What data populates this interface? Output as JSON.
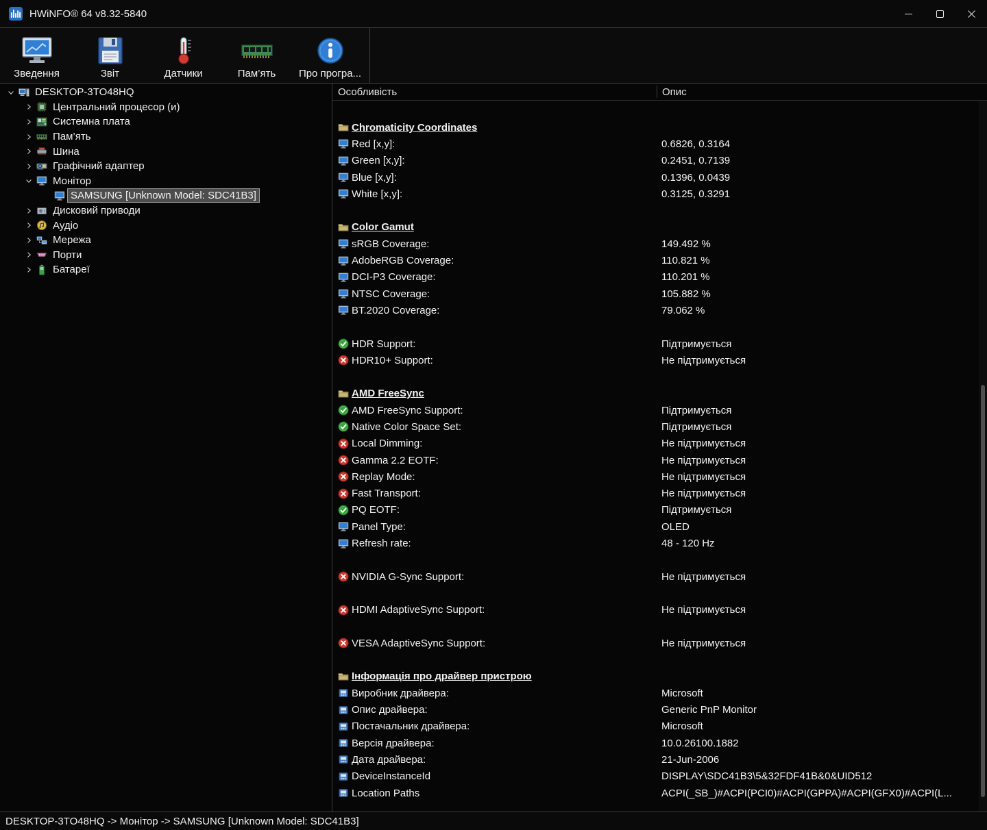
{
  "window": {
    "title": "HWiNFO® 64 v8.32-5840"
  },
  "toolbar": {
    "items": [
      {
        "name": "summary",
        "label": "Зведення",
        "icon": "summary-icon"
      },
      {
        "name": "report",
        "label": "Звіт",
        "icon": "report-icon"
      },
      {
        "name": "sensors",
        "label": "Датчики",
        "icon": "sensors-icon"
      },
      {
        "name": "memory",
        "label": "Пам’ять",
        "icon": "memory-toolbar-icon"
      },
      {
        "name": "about",
        "label": "Про програ...",
        "icon": "about-icon"
      }
    ]
  },
  "tree": {
    "items": [
      {
        "name": "desktop-root",
        "label": "DESKTOP-3TO48HQ",
        "icon": "computer-icon",
        "level": 0,
        "state": "expanded",
        "selected": false
      },
      {
        "name": "cpu",
        "label": "Центральний процесор (и)",
        "icon": "cpu-icon",
        "level": 1,
        "state": "collapsed",
        "selected": false
      },
      {
        "name": "motherboard",
        "label": "Системна плата",
        "icon": "motherboard-icon",
        "level": 1,
        "state": "collapsed",
        "selected": false
      },
      {
        "name": "memory",
        "label": "Пам’ять",
        "icon": "memory-icon",
        "level": 1,
        "state": "collapsed",
        "selected": false
      },
      {
        "name": "bus",
        "label": "Шина",
        "icon": "bus-icon",
        "level": 1,
        "state": "collapsed",
        "selected": false
      },
      {
        "name": "gpu",
        "label": "Графічний адаптер",
        "icon": "gpu-icon",
        "level": 1,
        "state": "collapsed",
        "selected": false
      },
      {
        "name": "monitor",
        "label": "Монітор",
        "icon": "monitor-icon",
        "level": 1,
        "state": "expanded",
        "selected": false
      },
      {
        "name": "samsung-sdc41b3",
        "label": "SAMSUNG [Unknown Model: SDC41B3]",
        "icon": "monitor-icon",
        "level": 2,
        "state": "leaf",
        "selected": true
      },
      {
        "name": "disk-drives",
        "label": "Дисковий приводи",
        "icon": "disk-icon",
        "level": 1,
        "state": "collapsed",
        "selected": false
      },
      {
        "name": "audio",
        "label": "Аудіо",
        "icon": "audio-icon",
        "level": 1,
        "state": "collapsed",
        "selected": false
      },
      {
        "name": "network",
        "label": "Мережа",
        "icon": "network-icon",
        "level": 1,
        "state": "collapsed",
        "selected": false
      },
      {
        "name": "ports",
        "label": "Порти",
        "icon": "ports-icon",
        "level": 1,
        "state": "collapsed",
        "selected": false
      },
      {
        "name": "batteries",
        "label": "Батареї",
        "icon": "battery-icon",
        "level": 1,
        "state": "collapsed",
        "selected": false
      }
    ]
  },
  "details": {
    "columns": [
      "Особливість",
      "Опис"
    ],
    "rows": [
      {
        "type": "section",
        "icon": "folder-icon",
        "label": "Chromaticity Coordinates"
      },
      {
        "type": "prop",
        "icon": "monitor-icon",
        "label": "Red [x,y]:",
        "value": "0.6826, 0.3164"
      },
      {
        "type": "prop",
        "icon": "monitor-icon",
        "label": "Green [x,y]:",
        "value": "0.2451, 0.7139"
      },
      {
        "type": "prop",
        "icon": "monitor-icon",
        "label": "Blue [x,y]:",
        "value": "0.1396, 0.0439"
      },
      {
        "type": "prop",
        "icon": "monitor-icon",
        "label": "White [x,y]:",
        "value": "0.3125, 0.3291"
      },
      {
        "type": "spacer"
      },
      {
        "type": "section",
        "icon": "folder-icon",
        "label": "Color Gamut"
      },
      {
        "type": "prop",
        "icon": "monitor-icon",
        "label": "sRGB Coverage:",
        "value": "149.492 %"
      },
      {
        "type": "prop",
        "icon": "monitor-icon",
        "label": "AdobeRGB Coverage:",
        "value": "110.821 %"
      },
      {
        "type": "prop",
        "icon": "monitor-icon",
        "label": "DCI-P3 Coverage:",
        "value": "110.201 %"
      },
      {
        "type": "prop",
        "icon": "monitor-icon",
        "label": "NTSC Coverage:",
        "value": "105.882 %"
      },
      {
        "type": "prop",
        "icon": "monitor-icon",
        "label": "BT.2020 Coverage:",
        "value": "79.062 %"
      },
      {
        "type": "spacer"
      },
      {
        "type": "prop",
        "icon": "check-icon",
        "label": "HDR Support:",
        "value": "Підтримується"
      },
      {
        "type": "prop",
        "icon": "cross-icon",
        "label": "HDR10+ Support:",
        "value": "Не підтримується"
      },
      {
        "type": "spacer"
      },
      {
        "type": "section",
        "icon": "folder-icon",
        "label": "AMD FreeSync"
      },
      {
        "type": "prop",
        "icon": "check-icon",
        "label": "AMD FreeSync Support:",
        "value": "Підтримується"
      },
      {
        "type": "prop",
        "icon": "check-icon",
        "label": "Native Color Space Set:",
        "value": "Підтримується"
      },
      {
        "type": "prop",
        "icon": "cross-icon",
        "label": "Local Dimming:",
        "value": "Не підтримується"
      },
      {
        "type": "prop",
        "icon": "cross-icon",
        "label": "Gamma 2.2 EOTF:",
        "value": "Не підтримується"
      },
      {
        "type": "prop",
        "icon": "cross-icon",
        "label": "Replay Mode:",
        "value": "Не підтримується"
      },
      {
        "type": "prop",
        "icon": "cross-icon",
        "label": "Fast Transport:",
        "value": "Не підтримується"
      },
      {
        "type": "prop",
        "icon": "check-icon",
        "label": "PQ EOTF:",
        "value": "Підтримується"
      },
      {
        "type": "prop",
        "icon": "monitor-icon",
        "label": "Panel Type:",
        "value": "OLED"
      },
      {
        "type": "prop",
        "icon": "monitor-icon",
        "label": "Refresh rate:",
        "value": "48 - 120 Hz"
      },
      {
        "type": "spacer"
      },
      {
        "type": "prop",
        "icon": "cross-icon",
        "label": "NVIDIA G-Sync Support:",
        "value": "Не підтримується"
      },
      {
        "type": "spacer"
      },
      {
        "type": "prop",
        "icon": "cross-icon",
        "label": "HDMI AdaptiveSync Support:",
        "value": "Не підтримується"
      },
      {
        "type": "spacer"
      },
      {
        "type": "prop",
        "icon": "cross-icon",
        "label": "VESA AdaptiveSync Support:",
        "value": "Не підтримується"
      },
      {
        "type": "spacer"
      },
      {
        "type": "section",
        "icon": "folder-icon",
        "label": "Інформація про драйвер пристрою"
      },
      {
        "type": "prop",
        "icon": "driver-icon",
        "label": "Виробник драйвера:",
        "value": "Microsoft"
      },
      {
        "type": "prop",
        "icon": "driver-icon",
        "label": "Опис драйвера:",
        "value": "Generic PnP Monitor"
      },
      {
        "type": "prop",
        "icon": "driver-icon",
        "label": "Постачальник драйвера:",
        "value": "Microsoft"
      },
      {
        "type": "prop",
        "icon": "driver-icon",
        "label": "Версія драйвера:",
        "value": "10.0.26100.1882"
      },
      {
        "type": "prop",
        "icon": "driver-icon",
        "label": "Дата драйвера:",
        "value": "21-Jun-2006"
      },
      {
        "type": "prop",
        "icon": "driver-icon",
        "label": "DeviceInstanceId",
        "value": "DISPLAY\\SDC41B3\\5&32FDF41B&0&UID512"
      },
      {
        "type": "prop",
        "icon": "driver-icon",
        "label": "Location Paths",
        "value": "ACPI(_SB_)#ACPI(PCI0)#ACPI(GPPA)#ACPI(GFX0)#ACPI(L..."
      }
    ]
  },
  "statusbar": {
    "text": "DESKTOP-3TO48HQ -> Монітор -> SAMSUNG [Unknown Model: SDC41B3]"
  },
  "colors": {
    "supported_green": "#36a53c",
    "unsupported_red": "#cf3a30",
    "selection_gray": "#4d4d4d",
    "accent_blue": "#2f7fd6"
  }
}
